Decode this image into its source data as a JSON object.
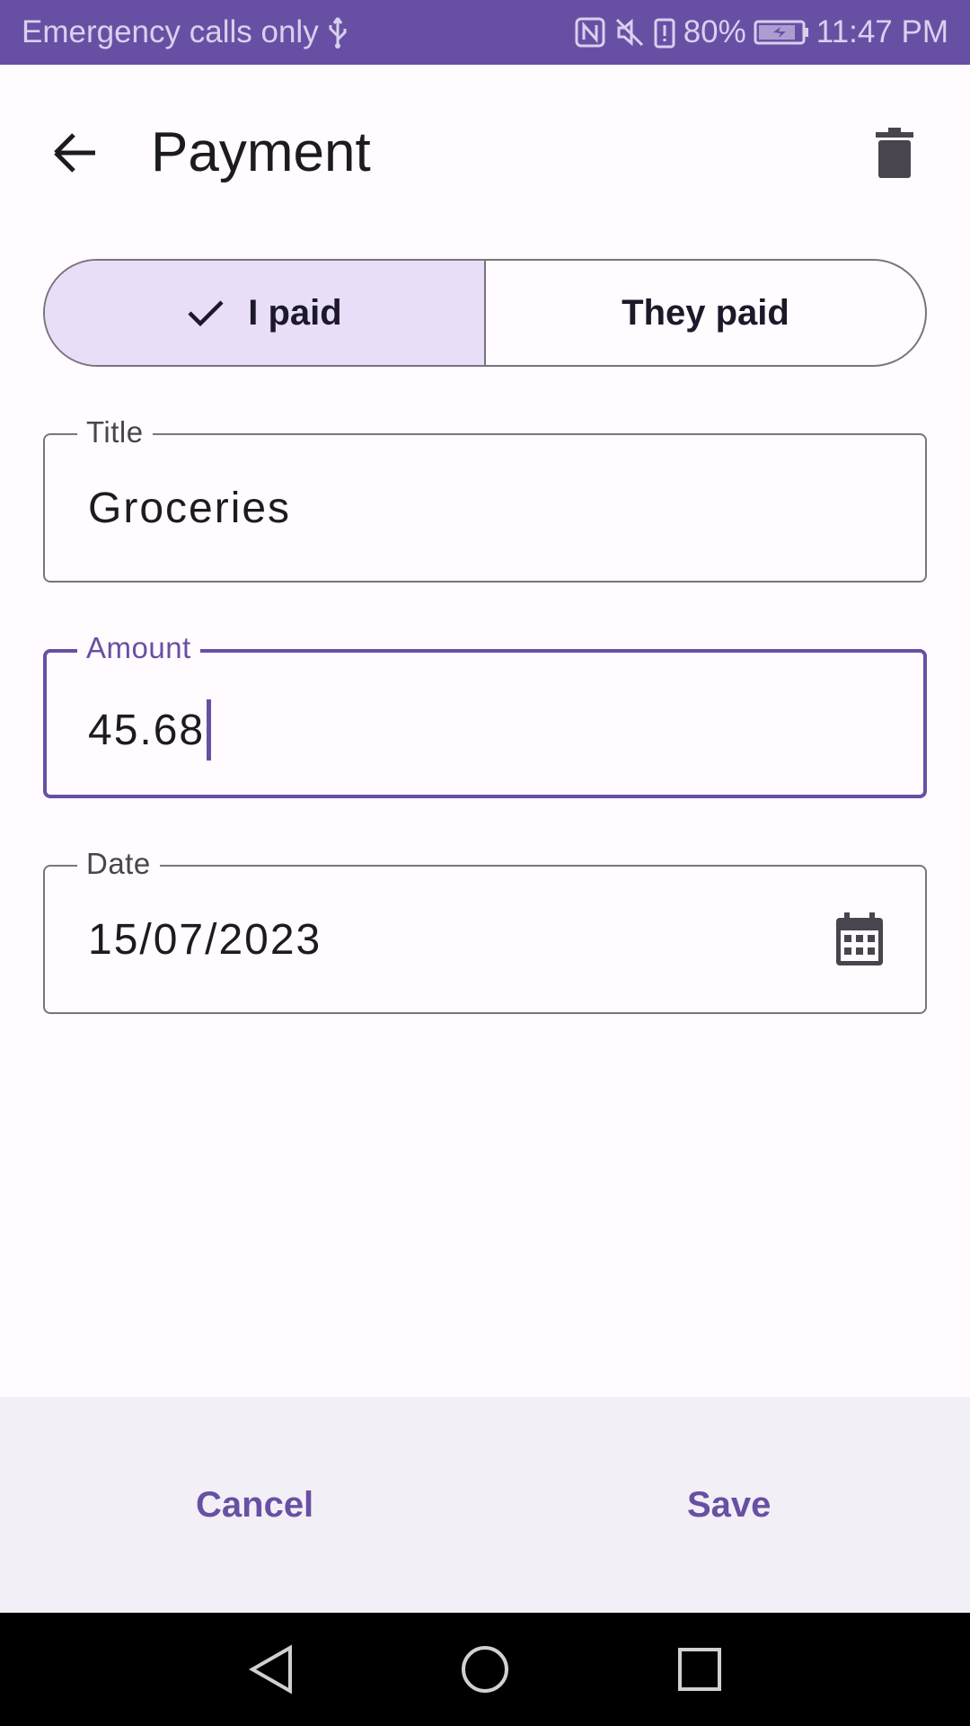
{
  "status_bar": {
    "carrier_text": "Emergency calls only",
    "battery_percent": "80%",
    "time": "11:47 PM",
    "background_color": "#6750a4"
  },
  "app_bar": {
    "title": "Payment",
    "back_icon": "arrow-left-icon",
    "delete_icon": "trash-icon"
  },
  "payer_toggle": {
    "options": [
      {
        "label": "I paid",
        "selected": true
      },
      {
        "label": "They paid",
        "selected": false
      }
    ],
    "selected_color": "#e8def8"
  },
  "form": {
    "title": {
      "label": "Title",
      "value": "Groceries"
    },
    "amount": {
      "label": "Amount",
      "value": "45.68",
      "focused": true
    },
    "date": {
      "label": "Date",
      "value": "15/07/2023",
      "icon": "calendar-icon"
    }
  },
  "actions": {
    "cancel_label": "Cancel",
    "save_label": "Save",
    "accent_color": "#6750a4"
  },
  "nav_bar": {
    "back_icon": "nav-back-icon",
    "home_icon": "nav-home-icon",
    "recents_icon": "nav-recents-icon"
  }
}
